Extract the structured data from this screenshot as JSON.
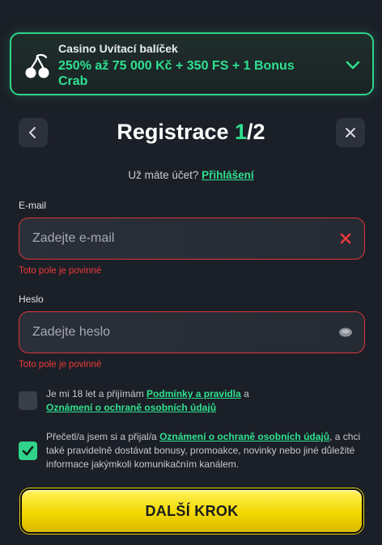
{
  "promo": {
    "label": "Casino Uvítací balíček",
    "title": "250% až 75 000 Kč + 350 FS + 1 Bonus Crab",
    "icon": "cherry-icon",
    "expand_icon": "chevron-down-icon"
  },
  "header": {
    "title": "Registrace",
    "step_current": "1",
    "step_total": "/2",
    "back_icon": "chevron-left-icon",
    "close_icon": "close-icon"
  },
  "login": {
    "prompt": "Už máte účet?",
    "link": "Přihlášení"
  },
  "email": {
    "label": "E-mail",
    "placeholder": "Zadejte e-mail",
    "value": "",
    "error": "Toto pole je povinné",
    "icon": "clear-x-icon"
  },
  "password": {
    "label": "Heslo",
    "placeholder": "Zadejte heslo",
    "value": "",
    "error": "Toto pole je povinné",
    "icon": "eye-icon"
  },
  "consent_age": {
    "checked": false,
    "text_1": "Je mi 18 let a přijímám ",
    "link_1": "Podmínky a pravidla",
    "text_2": " a",
    "link_2": "Oznámení o ochraně osobních údajů"
  },
  "consent_marketing": {
    "checked": true,
    "text_1": "Přečetl/a jsem si a přijal/a ",
    "link_1": "Oznámení o ochraně osobních údajů",
    "text_2": ", a chci také pravidelně dostávat bonusy, promoakce, novinky nebo jiné důležité informace jakýmkoli komunikačním kanálem."
  },
  "submit": {
    "label": "DALŠÍ KROK"
  },
  "colors": {
    "accent": "#2fe08f",
    "error": "#ee3a3a",
    "cta": "#f2d800",
    "background": "#1b1f27"
  }
}
